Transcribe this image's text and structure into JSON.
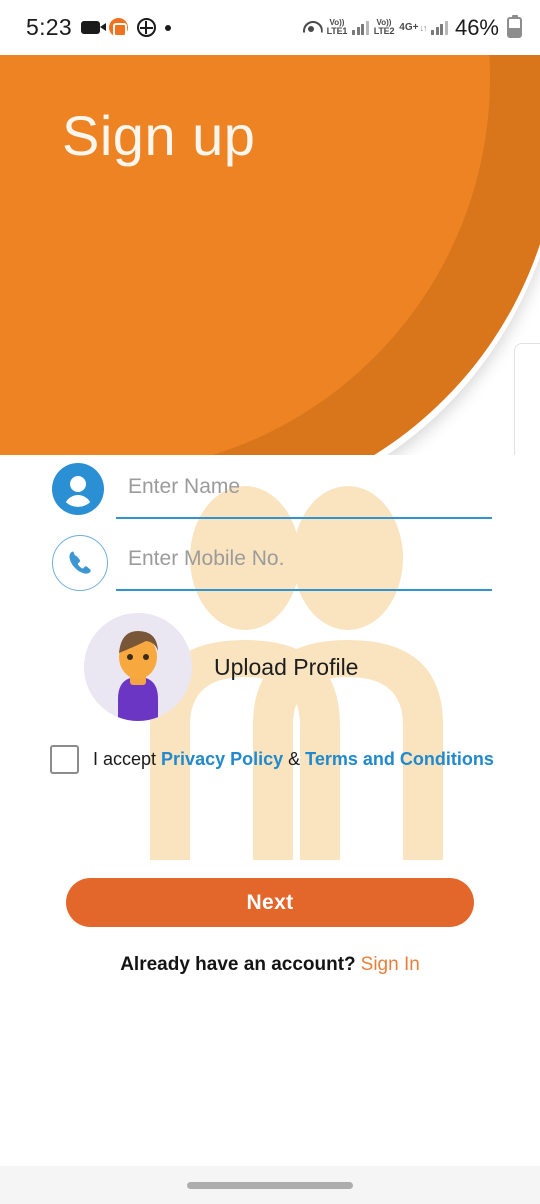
{
  "status_bar": {
    "time": "5:23",
    "icons_left": [
      "video-camera-icon",
      "orange-app-icon",
      "clover-icon",
      "small-dot-icon"
    ],
    "sim1": {
      "volte": "Vo))",
      "label": "LTE1"
    },
    "sim2": {
      "volte": "Vo))",
      "label": "LTE2"
    },
    "network_type": "4G+",
    "data_arrows": "↓↑",
    "battery_percent": "46%"
  },
  "header": {
    "title": "Sign up",
    "color_front": "#ED8322",
    "color_back": "#D9761C",
    "title_color": "#FCF6EF"
  },
  "form": {
    "name_field": {
      "placeholder": "Enter Name",
      "value": "",
      "icon": "person-circle-icon",
      "underline_color": "#2F93D4"
    },
    "mobile_field": {
      "placeholder": "Enter Mobile No.",
      "value": "",
      "icon": "phone-circle-icon",
      "underline_color": "#2F93D4"
    },
    "upload_profile": {
      "label": "Upload Profile",
      "avatar": "user-avatar-illustration"
    },
    "terms": {
      "checked": false,
      "prefix": "I accept ",
      "privacy_policy": "Privacy Policy",
      "separator": " & ",
      "terms_conditions": "Terms and Conditions",
      "link_color": "#2189CE"
    },
    "next_button": {
      "label": "Next",
      "color": "#E3672B"
    },
    "signin": {
      "prompt": "Already have an account?",
      "link": "Sign In",
      "link_color": "#E8803C"
    }
  },
  "nav_bar": {
    "home_indicator": "home-indicator"
  }
}
